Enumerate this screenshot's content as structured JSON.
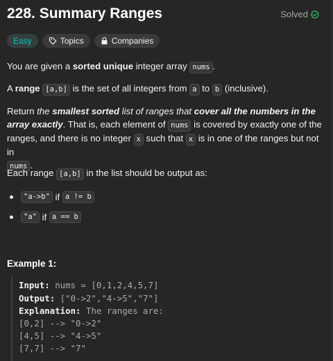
{
  "problem": {
    "title": "228. Summary Ranges",
    "status": "Solved",
    "tags": {
      "difficulty": "Easy",
      "topics": "Topics",
      "companies": "Companies"
    }
  },
  "p1": {
    "t1": "You are given a ",
    "b1": "sorted unique",
    "t2": " integer array ",
    "c1": "nums",
    "t3": "."
  },
  "p2": {
    "t1": "A ",
    "b1": "range",
    "t2": " ",
    "c1": "[a,b]",
    "t3": " is the set of all integers from ",
    "c2": "a",
    "t4": " to ",
    "c3": "b",
    "t5": " (inclusive)."
  },
  "p3": {
    "t1": "Return ",
    "i1": "the ",
    "bi1": "smallest sorted",
    "i2": " list of ranges that ",
    "bi2": "cover all the numbers in the",
    "bi3": "array exactly",
    "t2": ". That is, each element of ",
    "c1": "nums",
    "t3": " is covered by exactly one of the",
    "t4": "ranges, and there is no integer ",
    "c2": "x",
    "t5": " such that ",
    "c3": "x",
    "t6": " is in one of the ranges but not in",
    "c4": "nums",
    "t7": "."
  },
  "p4": {
    "t1": "Each range ",
    "c1": "[a,b]",
    "t2": " in the list should be output as:"
  },
  "bullets": [
    {
      "fmt": "\"a->b\"",
      "if": " if ",
      "cond": "a != b"
    },
    {
      "fmt": "\"a\"",
      "if": " if ",
      "cond": "a == b"
    }
  ],
  "example": {
    "heading": "Example 1:",
    "input_label": "Input:",
    "input_value": " nums = [0,1,2,4,5,7]",
    "output_label": "Output:",
    "output_value": " [\"0->2\",\"4->5\",\"7\"]",
    "explanation_label": "Explanation:",
    "explanation_value": " The ranges are:",
    "lines": [
      "[0,2] --> \"0->2\"",
      "[4,5] --> \"4->5\"",
      "[7,7] --> \"7\""
    ]
  },
  "colors": {
    "background": "#262626",
    "easy": "#1cbaba",
    "solved_check": "#2cbb5d"
  }
}
